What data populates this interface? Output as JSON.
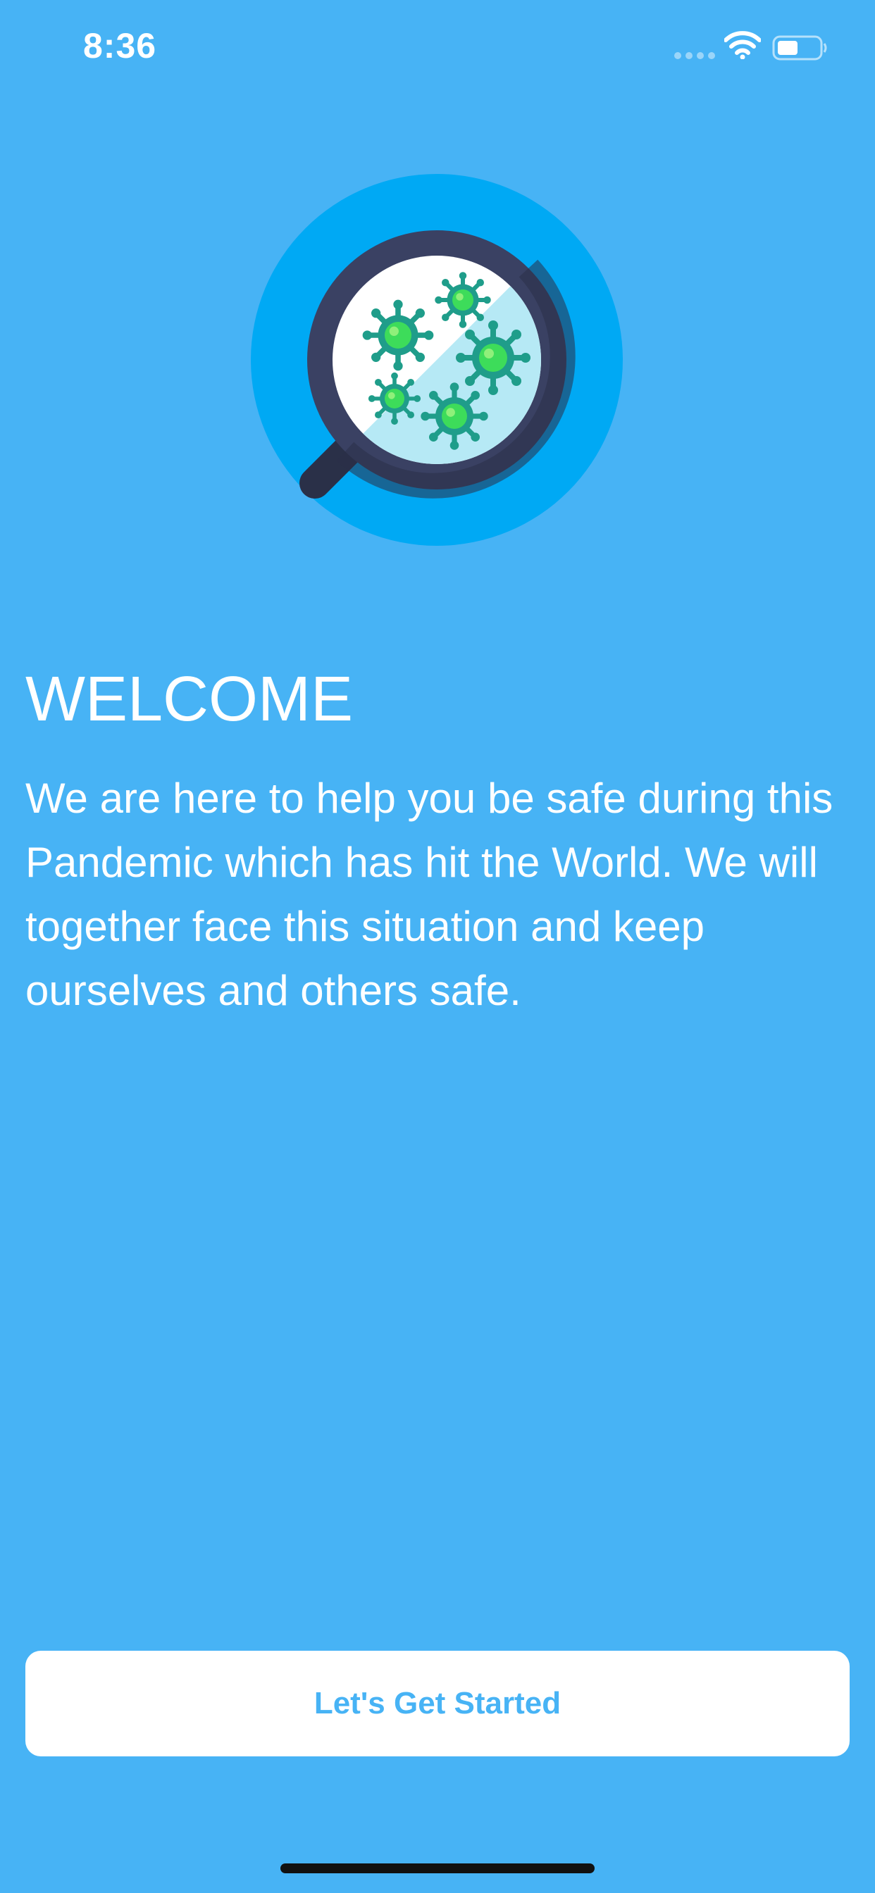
{
  "status_bar": {
    "time": "8:36",
    "icons": [
      "cellular-signal-icon",
      "wifi-icon",
      "battery-icon"
    ]
  },
  "logo": {
    "icon": "virus-magnifier-logo"
  },
  "welcome": {
    "title": "WELCOME",
    "body": "We are here to help you be safe during this Pandemic which has hit the World. We will together face this situation and keep ourselves and others safe."
  },
  "actions": {
    "start_label": "Let's Get Started"
  },
  "colors": {
    "background": "#47b3f5",
    "button_background": "#ffffff",
    "button_text": "#47b3f5",
    "text": "#ffffff"
  }
}
